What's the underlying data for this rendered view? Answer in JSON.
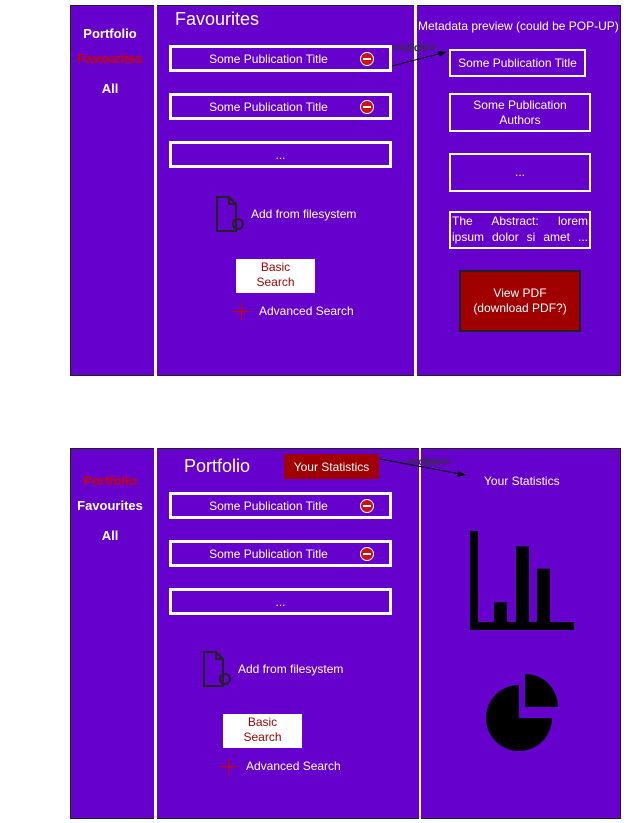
{
  "panel1": {
    "nav": [
      "Portfolio",
      "Favourites",
      "All"
    ],
    "heading": "Favourites",
    "publications": [
      "Some Publication Title",
      "Some Publication Title",
      "..."
    ],
    "add_from_filesystem": "Add from filesystem",
    "basic_search": "Basic\nSearch",
    "advanced_search": "Advanced Search",
    "click_annotation": "<<click>>",
    "metadata_preview_title": "Metadata preview (could be POP-UP)",
    "metadata": {
      "title": "Some Publication Title",
      "authors": "Some Publication\nAuthors",
      "ellipsis": "...",
      "abstract": "The Abstract: lorem ipsum dolor si amet ...",
      "view_pdf": "View PDF\n(download PDF?)"
    }
  },
  "panel2": {
    "nav": [
      "Portfolio",
      "Favourites",
      "All"
    ],
    "heading": "Portfolio",
    "stats_button": "Your Statistics",
    "publications": [
      "Some Publication Title",
      "Some Publication Title",
      "..."
    ],
    "add_from_filesystem": "Add from filesystem",
    "basic_search": "Basic\nSearch",
    "advanced_search": "Advanced Search",
    "click_annotation": "<<click>>",
    "stats_title": "Your Statistics",
    "bar_chart_values": [
      0.23,
      0.88,
      0.62
    ]
  },
  "colors": {
    "panel": "#6600cc",
    "active_nav": "#cc0000",
    "accent_red": "#a00000",
    "remove_icon": "#cc1111"
  }
}
